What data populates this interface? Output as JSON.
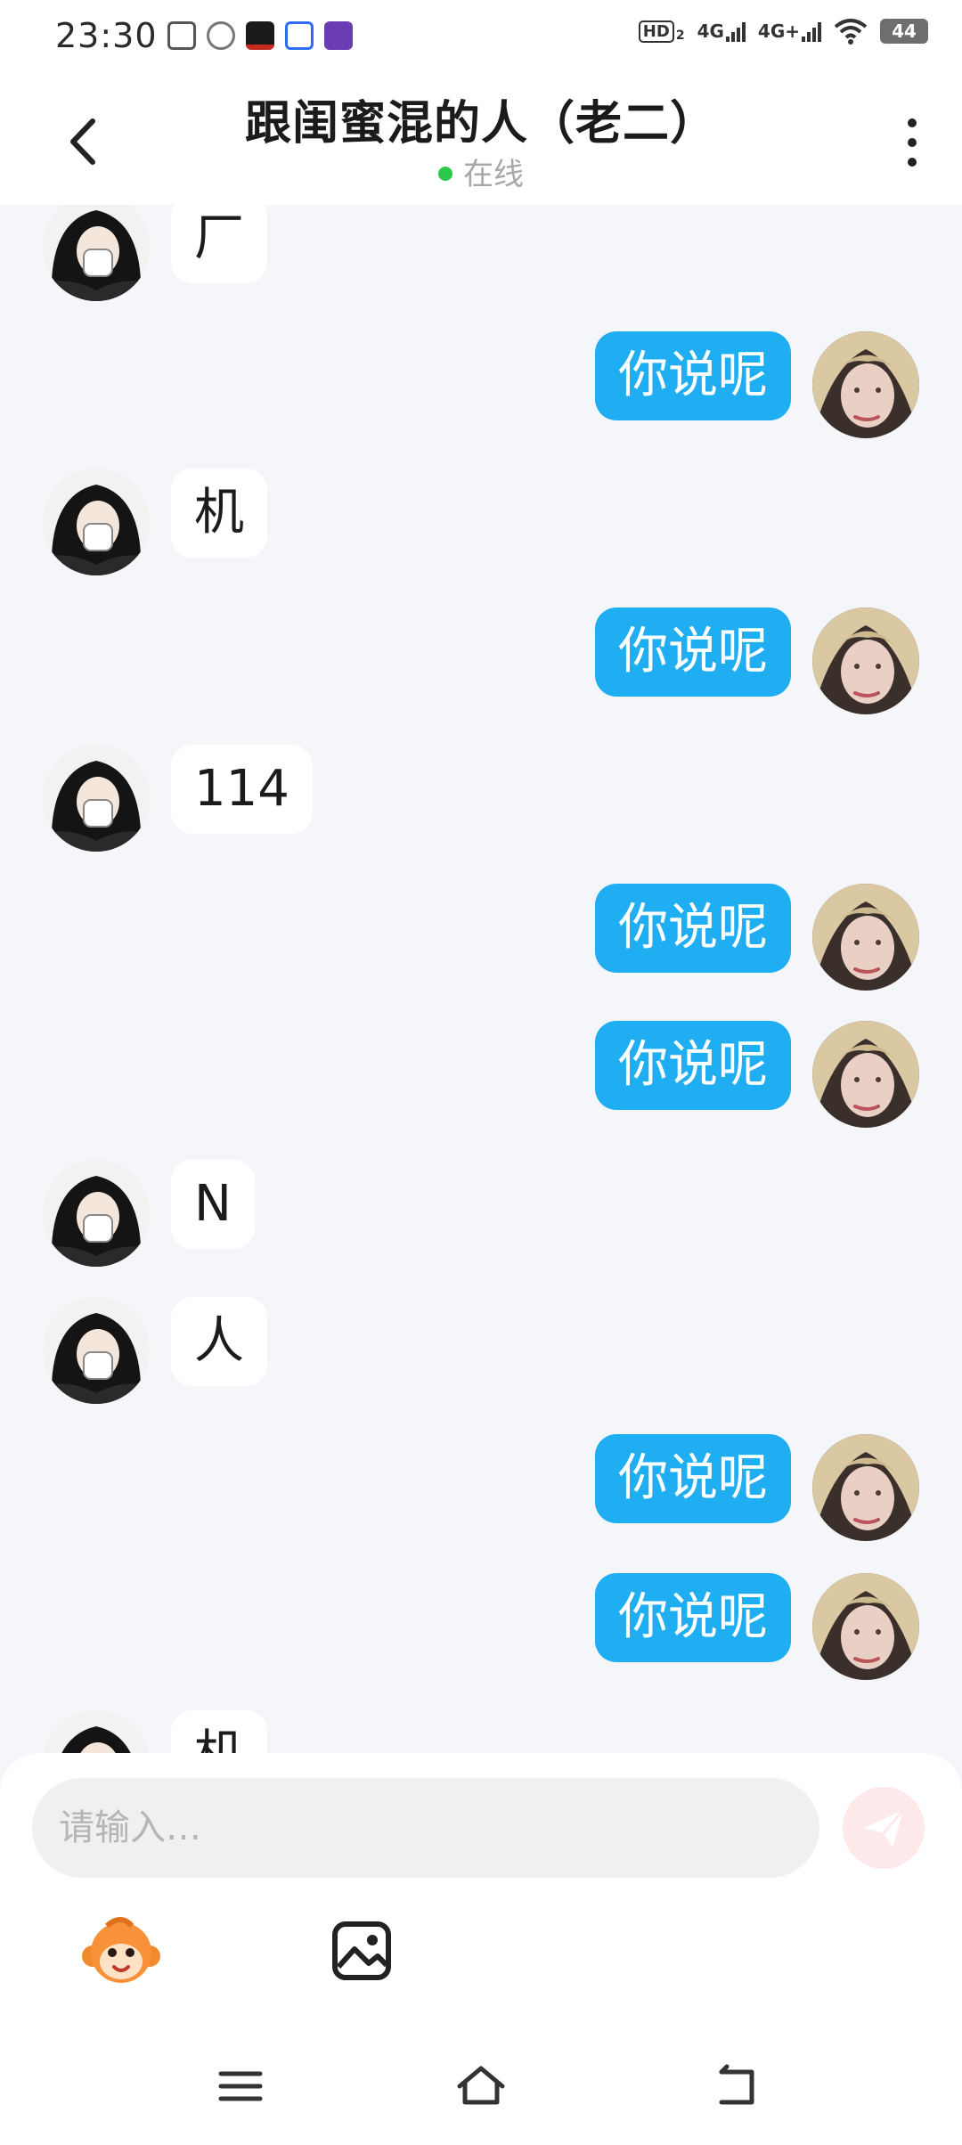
{
  "status_bar": {
    "time": "23:30",
    "network_1": "HD",
    "network_1_sub": "2",
    "network_2": "4G",
    "network_3": "4G+",
    "battery": "44",
    "colors": {
      "app_1": "#555555",
      "app_2": "#777777",
      "app_3": "#c42a1e",
      "app_4": "#2e6df2",
      "app_5": "#6b3db3"
    }
  },
  "header": {
    "back_icon": "chevron-left-icon",
    "title": "跟闺蜜混的人（老二）",
    "status": "在线",
    "status_color": "#2bc84a",
    "more_icon": "more-vertical-icon"
  },
  "messages": [
    {
      "side": "left",
      "text": "厂"
    },
    {
      "side": "right",
      "text": "你说呢"
    },
    {
      "side": "left",
      "text": "机"
    },
    {
      "side": "right",
      "text": "你说呢"
    },
    {
      "side": "left",
      "text": "114"
    },
    {
      "side": "right",
      "text": "你说呢"
    },
    {
      "side": "right",
      "text": "你说呢"
    },
    {
      "side": "left",
      "text": "N"
    },
    {
      "side": "left",
      "text": "人"
    },
    {
      "side": "right",
      "text": "你说呢"
    },
    {
      "side": "right",
      "text": "你说呢"
    },
    {
      "side": "left",
      "text": "机"
    }
  ],
  "composer": {
    "placeholder": "请输入…",
    "send_icon": "paper-plane-icon",
    "emoji_icon": "monkey-emoji-icon",
    "image_icon": "image-icon"
  },
  "nav": {
    "menu_icon": "menu-icon",
    "home_icon": "home-icon",
    "back_icon": "back-icon"
  },
  "colors": {
    "accent_bubble": "#1faef2",
    "chat_background": "#f4f6f9",
    "send_button": "#fde9ea"
  }
}
